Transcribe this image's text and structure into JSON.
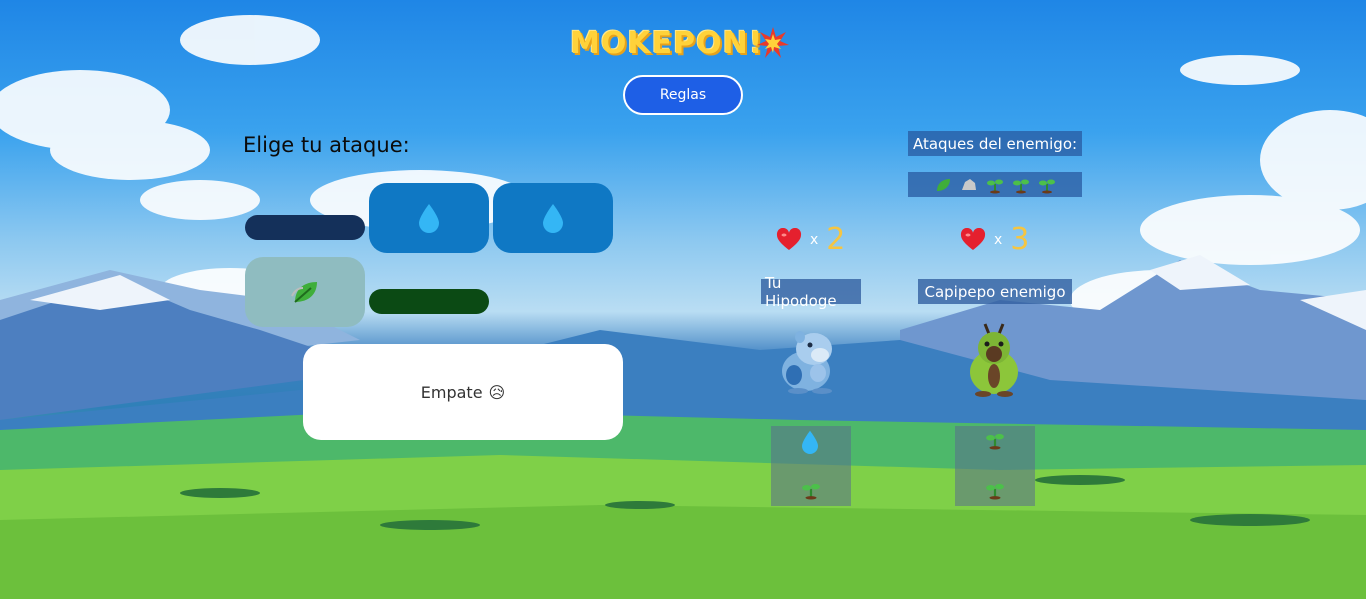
{
  "header": {
    "title": "MOKEPON!",
    "rules_label": "Reglas"
  },
  "player_panel": {
    "choose_title": "Elige tu ataque:",
    "attack_buttons": [
      {
        "icon": "water-drop-icon"
      },
      {
        "icon": "water-drop-icon"
      },
      {
        "icon": "leaf-icon"
      }
    ],
    "result_text": "Empate",
    "result_emoji": "😥"
  },
  "enemy_panel": {
    "label": "Ataques del enemigo:",
    "attacks": [
      "leaf-icon",
      "rock-icon",
      "sprout-icon",
      "sprout-icon",
      "sprout-icon"
    ]
  },
  "battle": {
    "player": {
      "lives": "2",
      "name": "Tu Hipodoge",
      "attacks": [
        "water-drop-icon",
        "sprout-icon"
      ]
    },
    "enemy": {
      "lives": "3",
      "name": "Capipepo enemigo",
      "attacks": [
        "sprout-icon",
        "sprout-icon"
      ]
    },
    "times_sign": "x"
  },
  "colors": {
    "accent": "#1e5fe6",
    "title": "#ffd23a",
    "attack_blue": "#0f78c4",
    "lives": "#f5c542"
  }
}
